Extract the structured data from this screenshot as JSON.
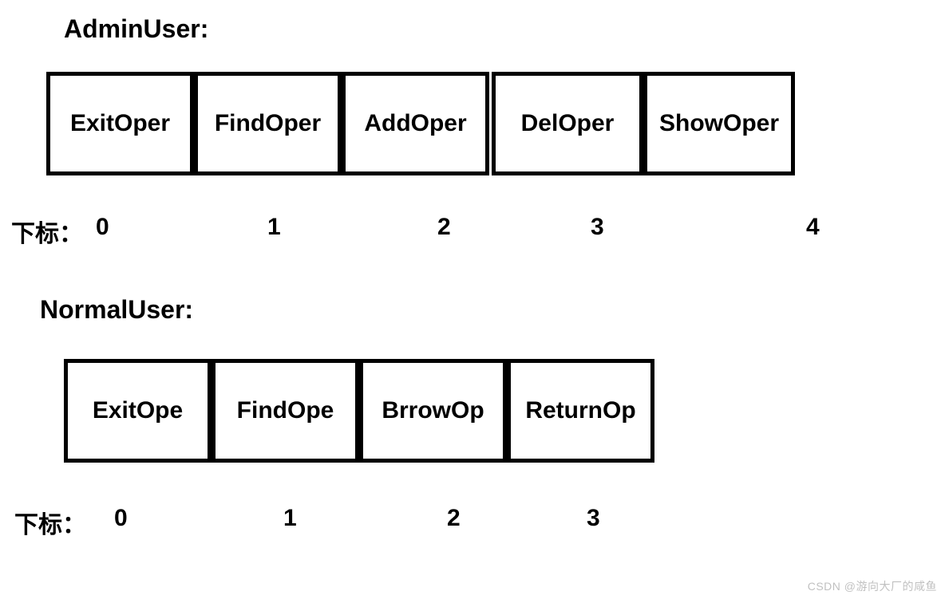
{
  "sections": [
    {
      "title": "AdminUser:",
      "index_label": "下标：",
      "cells": [
        "ExitOper",
        "FindOper",
        "AddOper",
        "DelOper",
        "ShowOper"
      ],
      "indices": [
        "0",
        "1",
        "2",
        "3",
        "4"
      ]
    },
    {
      "title": "NormalUser:",
      "index_label": "下标：",
      "cells": [
        "ExitOpe",
        "FindOpe",
        "BrrowOp",
        "ReturnOp"
      ],
      "indices": [
        "0",
        "1",
        "2",
        "3"
      ]
    }
  ],
  "watermark": "CSDN @游向大厂的咸鱼"
}
